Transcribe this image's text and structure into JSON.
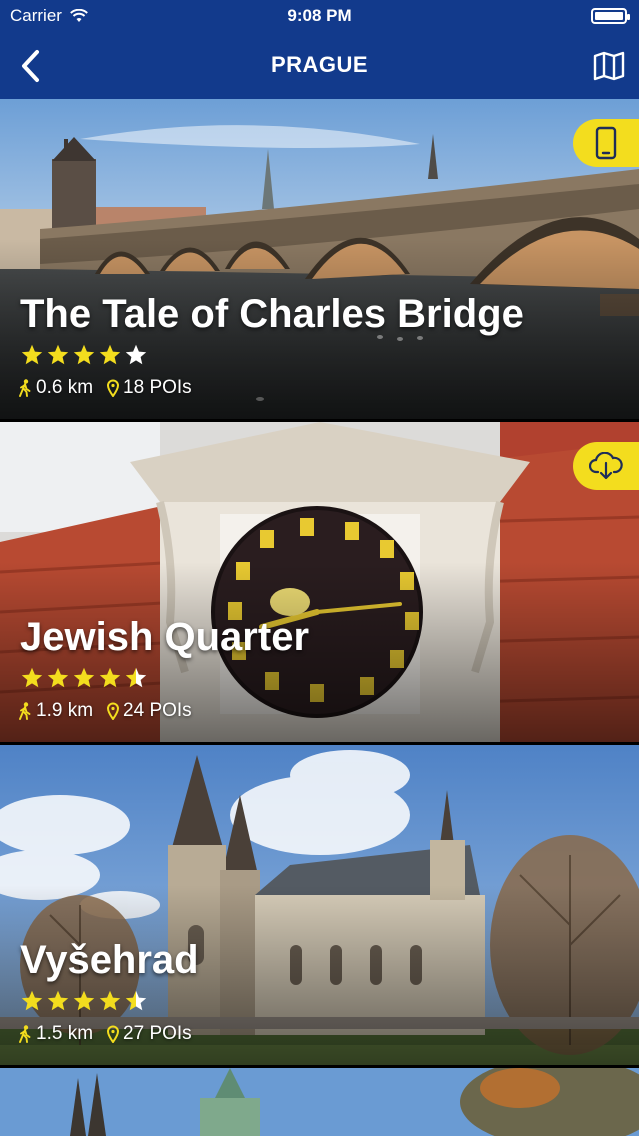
{
  "status": {
    "carrier": "Carrier",
    "time": "9:08 PM"
  },
  "nav": {
    "title": "PRAGUE"
  },
  "colors": {
    "header": "#123a8c",
    "accent": "#f3dd1e",
    "star": "#f3dd1e"
  },
  "tours": [
    {
      "title": "The Tale of Charles Bridge",
      "rating": 4,
      "distance": "0.6 km",
      "pois": "18 POIs",
      "badge_icon": "phone-icon"
    },
    {
      "title": "Jewish Quarter",
      "rating": 4.5,
      "distance": "1.9 km",
      "pois": "24 POIs",
      "badge_icon": "cloud-download-icon"
    },
    {
      "title": "Vyšehrad",
      "rating": 4.5,
      "distance": "1.5 km",
      "pois": "27 POIs"
    }
  ]
}
